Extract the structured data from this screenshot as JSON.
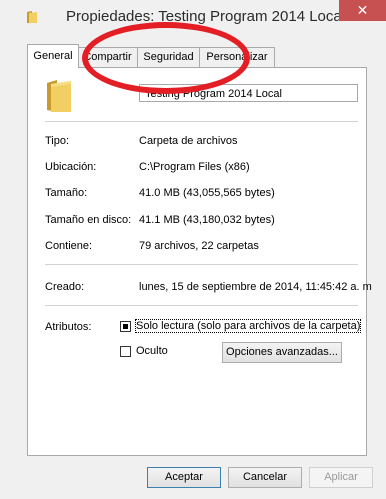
{
  "window": {
    "title": "Propiedades: Testing Program 2014 Local",
    "close_glyph": "✕"
  },
  "tabs": [
    {
      "label": "General",
      "active": true
    },
    {
      "label": "Compartir",
      "active": false
    },
    {
      "label": "Seguridad",
      "active": false
    },
    {
      "label": "Personalizar",
      "active": false
    }
  ],
  "general": {
    "folder_name": "Testing Program 2014 Local",
    "rows": {
      "tipo": {
        "label": "Tipo:",
        "value": "Carpeta de archivos"
      },
      "ubicacion": {
        "label": "Ubicación:",
        "value": "C:\\Program Files (x86)"
      },
      "tamano": {
        "label": "Tamaño:",
        "value": "41.0 MB (43,055,565 bytes)"
      },
      "tamano_disco": {
        "label": "Tamaño en disco:",
        "value": "41.1 MB (43,180,032 bytes)"
      },
      "contiene": {
        "label": "Contiene:",
        "value": "79 archivos, 22 carpetas"
      },
      "creado": {
        "label": "Creado:",
        "value": "lunes, 15 de septiembre de 2014, 11:45:42 a. m"
      }
    },
    "atributos": {
      "label": "Atributos:",
      "readonly_label": "Solo lectura (solo para archivos de la carpeta)",
      "readonly_state": "indeterminate",
      "hidden_label": "Oculto",
      "hidden_checked": false,
      "advanced_button": "Opciones avanzadas..."
    }
  },
  "footer": {
    "ok": "Aceptar",
    "cancel": "Cancelar",
    "apply": "Aplicar"
  },
  "colors": {
    "annotation_oval": "#e41e25",
    "close_button": "#c75050",
    "folder": "#e8c04a"
  },
  "annotation": {
    "shape": "red-oval",
    "target": "tab-compartir"
  }
}
